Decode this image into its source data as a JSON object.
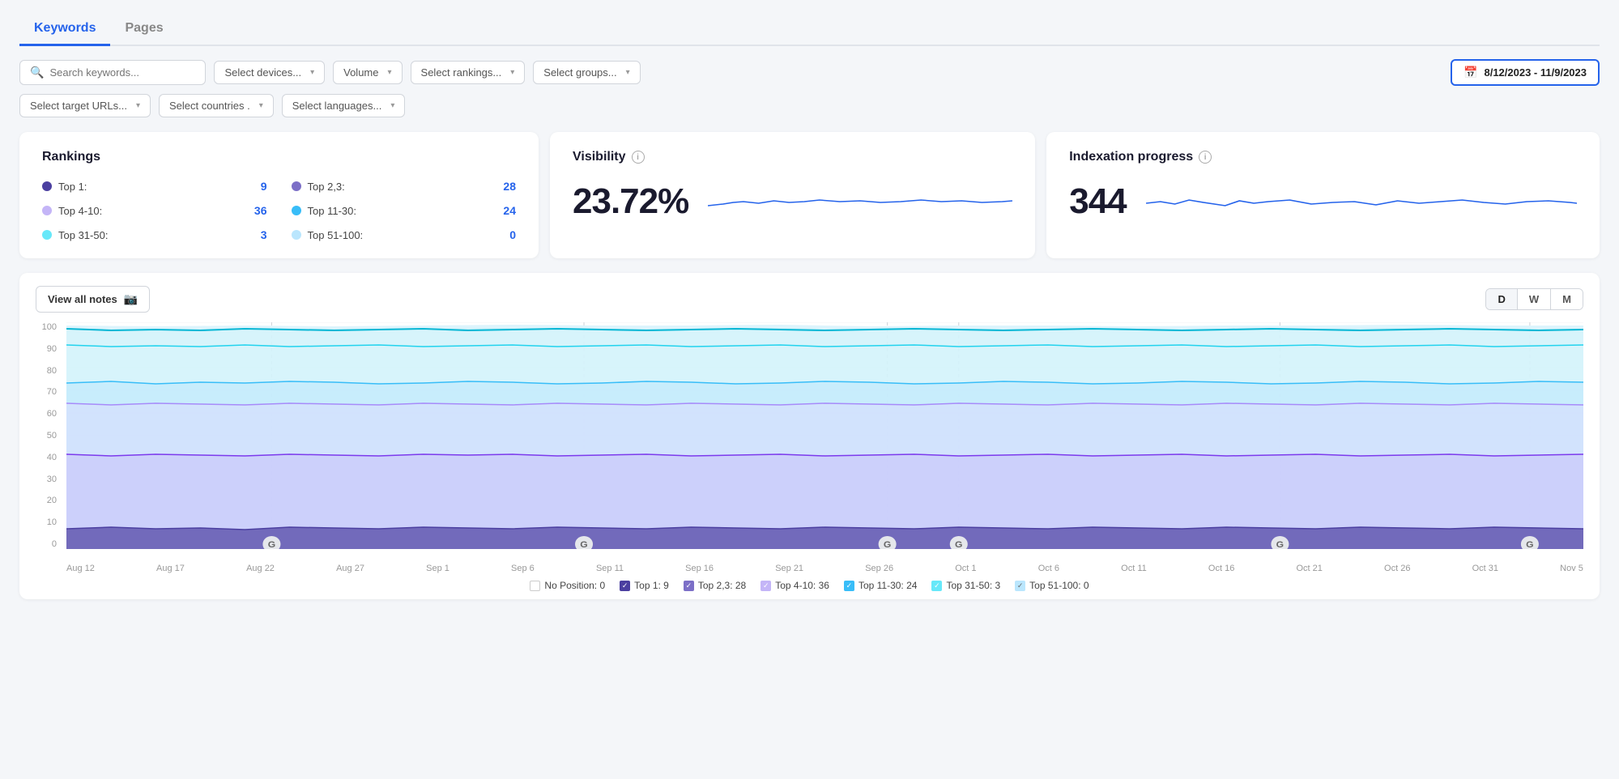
{
  "tabs": [
    {
      "id": "keywords",
      "label": "Keywords",
      "active": true
    },
    {
      "id": "pages",
      "label": "Pages",
      "active": false
    }
  ],
  "filters": {
    "search_placeholder": "Search keywords...",
    "devices_label": "Select devices...",
    "volume_label": "Volume",
    "rankings_label": "Select rankings...",
    "groups_label": "Select groups...",
    "date_range": "8/12/2023 - 11/9/2023",
    "target_urls_label": "Select target URLs...",
    "countries_label": "Select countries .",
    "languages_label": "Select languages..."
  },
  "rankings_card": {
    "title": "Rankings",
    "rows": [
      {
        "label": "Top 1:",
        "value": "9",
        "color": "#4b3fa0"
      },
      {
        "label": "Top 4-10:",
        "value": "36",
        "color": "#c4b5f7"
      },
      {
        "label": "Top 31-50:",
        "value": "3",
        "color": "#67e8f9"
      },
      {
        "label": "Top 2,3:",
        "value": "28",
        "color": "#7c6fc7"
      },
      {
        "label": "Top 11-30:",
        "value": "24",
        "color": "#38bdf8"
      },
      {
        "label": "Top 51-100:",
        "value": "0",
        "color": "#bae6fd"
      }
    ]
  },
  "visibility_card": {
    "title": "Visibility",
    "value": "23.72%"
  },
  "indexation_card": {
    "title": "Indexation progress",
    "value": "344"
  },
  "chart": {
    "view_all_notes_label": "View all notes",
    "period_buttons": [
      "D",
      "W",
      "M"
    ],
    "active_period": "D",
    "y_labels": [
      "100",
      "90",
      "80",
      "70",
      "60",
      "50",
      "40",
      "30",
      "20",
      "10",
      "0"
    ],
    "x_labels": [
      "Aug 12",
      "Aug 17",
      "Aug 22",
      "Aug 27",
      "Sep 1",
      "Sep 6",
      "Sep 11",
      "Sep 16",
      "Sep 21",
      "Sep 26",
      "Oct 1",
      "Oct 6",
      "Oct 11",
      "Oct 16",
      "Oct 21",
      "Oct 26",
      "Oct 31",
      "Nov 5"
    ]
  },
  "legend": [
    {
      "label": "No Position: 0",
      "type": "checkbox",
      "checked": false,
      "color": "#fff"
    },
    {
      "label": "Top 1: 9",
      "type": "checkbox",
      "checked": true,
      "color": "#4b3fa0"
    },
    {
      "label": "Top 2,3: 28",
      "type": "checkbox",
      "checked": true,
      "color": "#7c6fc7"
    },
    {
      "label": "Top 4-10: 36",
      "type": "checkbox",
      "checked": true,
      "color": "#c4b5f7"
    },
    {
      "label": "Top 11-30: 24",
      "type": "checkbox",
      "checked": true,
      "color": "#38bdf8"
    },
    {
      "label": "Top 31-50: 3",
      "type": "checkbox",
      "checked": true,
      "color": "#67e8f9"
    },
    {
      "label": "Top 51-100: 0",
      "type": "checkbox",
      "checked": true,
      "color": "#bae6fd"
    }
  ],
  "icons": {
    "search": "🔍",
    "calendar": "📅",
    "chevron_down": "▾",
    "pin": "📌",
    "info": "i"
  }
}
